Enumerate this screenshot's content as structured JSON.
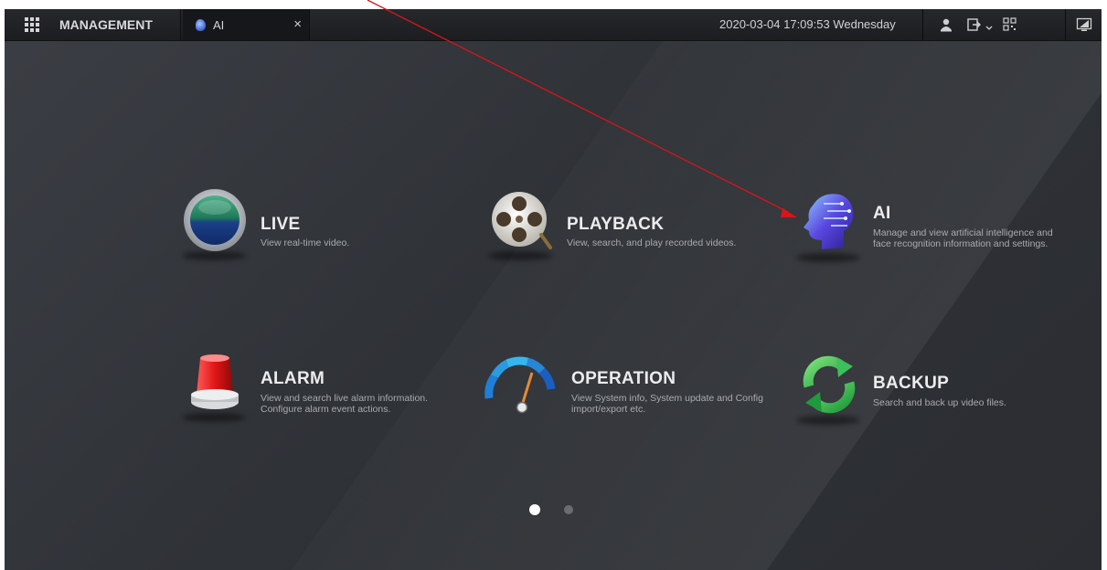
{
  "topbar": {
    "menu_label": "MANAGEMENT",
    "tab_label": "AI",
    "tab_close": "×",
    "datetime": "2020-03-04 17:09:53 Wednesday"
  },
  "modules": [
    {
      "title": "LIVE",
      "desc": "View real-time video."
    },
    {
      "title": "PLAYBACK",
      "desc": "View, search, and play recorded videos."
    },
    {
      "title": "AI",
      "desc": "Manage and view artificial intelligence and face recognition information and settings."
    },
    {
      "title": "ALARM",
      "desc": "View and search live alarm information. Configure alarm event actions."
    },
    {
      "title": "OPERATION",
      "desc": "View System info, System update and Config import/export etc."
    },
    {
      "title": "BACKUP",
      "desc": "Search and back up video files."
    }
  ],
  "pagination": {
    "current": 1,
    "total": 2
  },
  "icons": {
    "menu": "grid-icon",
    "tab": "ai-head-icon",
    "user": "user-icon",
    "logout": "logout-icon",
    "qr": "qr-code-icon",
    "display": "monitor-icon"
  },
  "colors": {
    "accent_arrow": "#d9141a",
    "dot_active": "#ffffff",
    "dot_inactive": "#6a6c70"
  }
}
